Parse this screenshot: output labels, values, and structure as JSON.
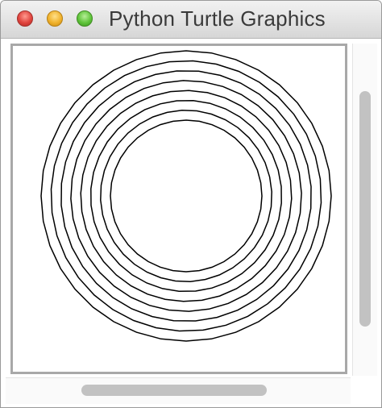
{
  "window": {
    "title": "Python Turtle Graphics"
  },
  "controls": {
    "close": "close-icon",
    "minimize": "minimize-icon",
    "maximize": "maximize-icon"
  },
  "canvas": {
    "drawing": "concentric polygon rings",
    "rings": 8,
    "stroke_color": "#000000",
    "background_color": "#ffffff"
  },
  "colors": {
    "close": "#e0443e",
    "minimize": "#f0b22c",
    "maximize": "#5fc43a",
    "scrollbar_thumb": "#c2c2c2"
  }
}
